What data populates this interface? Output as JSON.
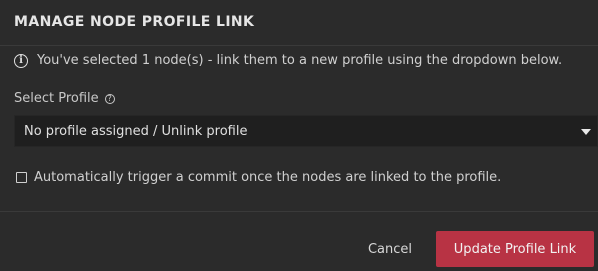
{
  "dialog": {
    "title": "MANAGE NODE PROFILE LINK",
    "info_text": "You've selected 1 node(s) - link them to a new profile using the dropdown below.",
    "select_label": "Select Profile",
    "dropdown_value": "No profile assigned / Unlink profile",
    "checkbox_label": "Automatically trigger a commit once the nodes are linked to the profile.",
    "checkbox_checked": false,
    "cancel_label": "Cancel",
    "submit_label": "Update Profile Link"
  },
  "icons": {
    "info": "info-icon",
    "help": "help-icon",
    "dropdown": "caret-down-icon"
  },
  "colors": {
    "background": "#2b2b2b",
    "input_background": "#1f1f1f",
    "primary_button": "#b83344"
  }
}
